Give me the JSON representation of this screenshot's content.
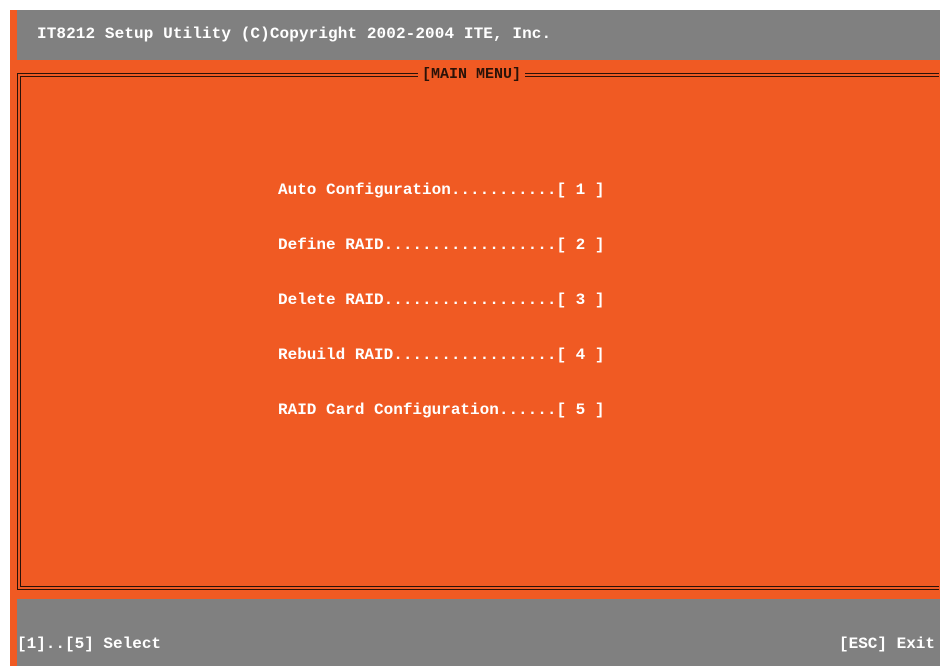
{
  "title_bar": {
    "text": "IT8212 Setup Utility (C)Copyright 2002-2004 ITE, Inc."
  },
  "main_menu": {
    "frame_title": "[MAIN MENU]",
    "items": [
      {
        "label": "Auto Configuration...........[ 1 ]"
      },
      {
        "label": "Define RAID..................[ 2 ]"
      },
      {
        "label": "Delete RAID..................[ 3 ]"
      },
      {
        "label": "Rebuild RAID.................[ 4 ]"
      },
      {
        "label": "RAID Card Configuration......[ 5 ]"
      }
    ]
  },
  "status_bar": {
    "left": "[1]..[5] Select",
    "right": "[ESC] Exit"
  },
  "colors": {
    "background": "#f05a23",
    "bars": "#808080",
    "text": "#ffffff",
    "frame": "#2a1208"
  }
}
